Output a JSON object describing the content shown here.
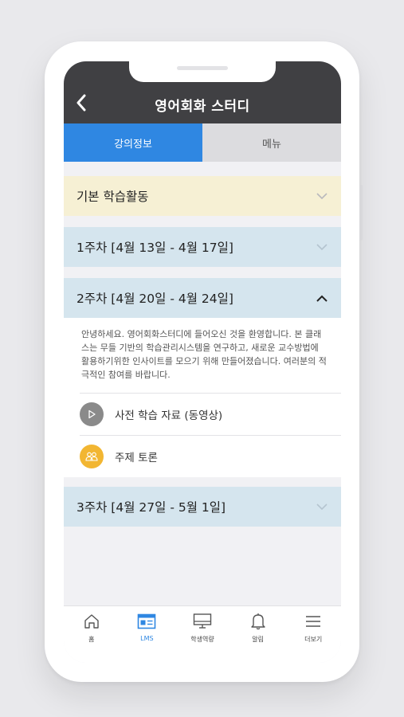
{
  "header": {
    "title": "영어회화 스터디"
  },
  "tabs": [
    {
      "label": "강의정보",
      "active": true
    },
    {
      "label": "메뉴",
      "active": false
    }
  ],
  "sections": {
    "basic": {
      "label": "기본 학습활동",
      "expanded": false
    },
    "week1": {
      "label": "1주차 [4월 13일 - 4월 17일]",
      "expanded": false
    },
    "week2": {
      "label": "2주차 [4월 20일 - 4월 24일]",
      "expanded": true
    },
    "week3": {
      "label": "3주차 [4월 27일 - 5월 1일]",
      "expanded": false
    }
  },
  "week2_panel": {
    "description": "안녕하세요. 영어회화스터디에 들어오신 것을 환영합니다. 본 클래스는 무들 기반의 학습관리시스템을 연구하고, 새로운 교수방법에 활용하기위한 인사이트를 모으기 위해 만들어졌습니다. 여러분의 적극적인 참여를 바랍니다.",
    "items": [
      {
        "label": "사전 학습 자료 (동영상)",
        "icon": "play-icon",
        "color": "#8a8a8a"
      },
      {
        "label": "주제 토론",
        "icon": "people-icon",
        "color": "#f2b632"
      }
    ]
  },
  "bottom_nav": [
    {
      "label": "홈",
      "icon": "home-icon",
      "active": false
    },
    {
      "label": "LMS",
      "icon": "lms-icon",
      "active": true
    },
    {
      "label": "학생역량",
      "icon": "monitor-icon",
      "active": false
    },
    {
      "label": "알림",
      "icon": "bell-icon",
      "active": false
    },
    {
      "label": "더보기",
      "icon": "menu-icon",
      "active": false
    }
  ],
  "colors": {
    "header_bg": "#404043",
    "accent": "#2f87e2",
    "basic_section_bg": "#f6f0d4",
    "week_section_bg": "#d5e5ee"
  }
}
